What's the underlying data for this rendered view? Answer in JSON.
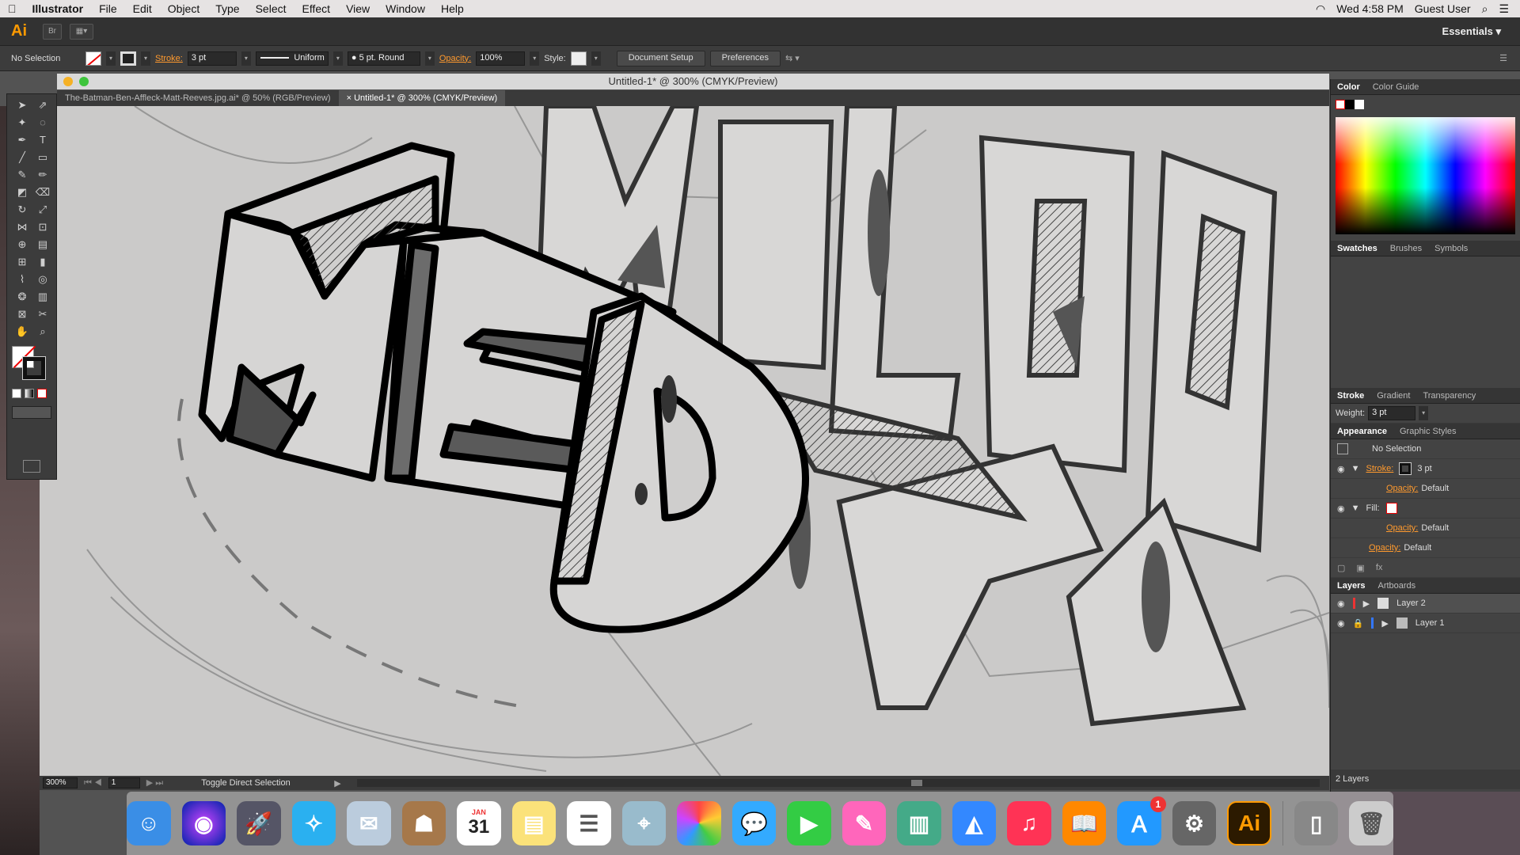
{
  "menubar": {
    "apple": "",
    "app": "Illustrator",
    "items": [
      "File",
      "Edit",
      "Object",
      "Type",
      "Select",
      "Effect",
      "View",
      "Window",
      "Help"
    ],
    "clock": "Wed 4:58 PM",
    "user": "Guest User"
  },
  "appbar": {
    "logo": "Ai",
    "br": "Br",
    "workspace": "Essentials"
  },
  "control": {
    "selection": "No Selection",
    "stroke_label": "Stroke:",
    "stroke_weight": "3 pt",
    "profile": "Uniform",
    "brush": "5 pt. Round",
    "opacity_label": "Opacity:",
    "opacity": "100%",
    "style_label": "Style:",
    "doc_setup": "Document Setup",
    "preferences": "Preferences"
  },
  "document": {
    "title": "Untitled-1* @ 300% (CMYK/Preview)",
    "tabs": [
      "The-Batman-Ben-Affleck-Matt-Reeves.jpg.ai* @ 50% (RGB/Preview)",
      "Untitled-1* @ 300% (CMYK/Preview)"
    ]
  },
  "status": {
    "zoom": "300%",
    "page": "1",
    "message": "Toggle Direct Selection"
  },
  "panels": {
    "color_tabs": [
      "Color",
      "Color Guide"
    ],
    "swatch_tabs": [
      "Swatches",
      "Brushes",
      "Symbols"
    ],
    "stroke_tabs": [
      "Stroke",
      "Gradient",
      "Transparency"
    ],
    "weight_label": "Weight:",
    "weight": "3 pt",
    "appearance_tabs": [
      "Appearance",
      "Graphic Styles"
    ],
    "appearance": {
      "title": "No Selection",
      "stroke": "Stroke:",
      "stroke_val": "3 pt",
      "opacity": "Opacity:",
      "opacity_val": "Default",
      "fill": "Fill:"
    },
    "layer_tabs": [
      "Layers",
      "Artboards"
    ],
    "layers": [
      "Layer 2",
      "Layer 1"
    ],
    "layer_count": "2 Layers"
  },
  "dock": {
    "calendar_month": "JAN",
    "calendar_day": "31",
    "appstore_badge": "1",
    "ai_label": "Ai"
  }
}
